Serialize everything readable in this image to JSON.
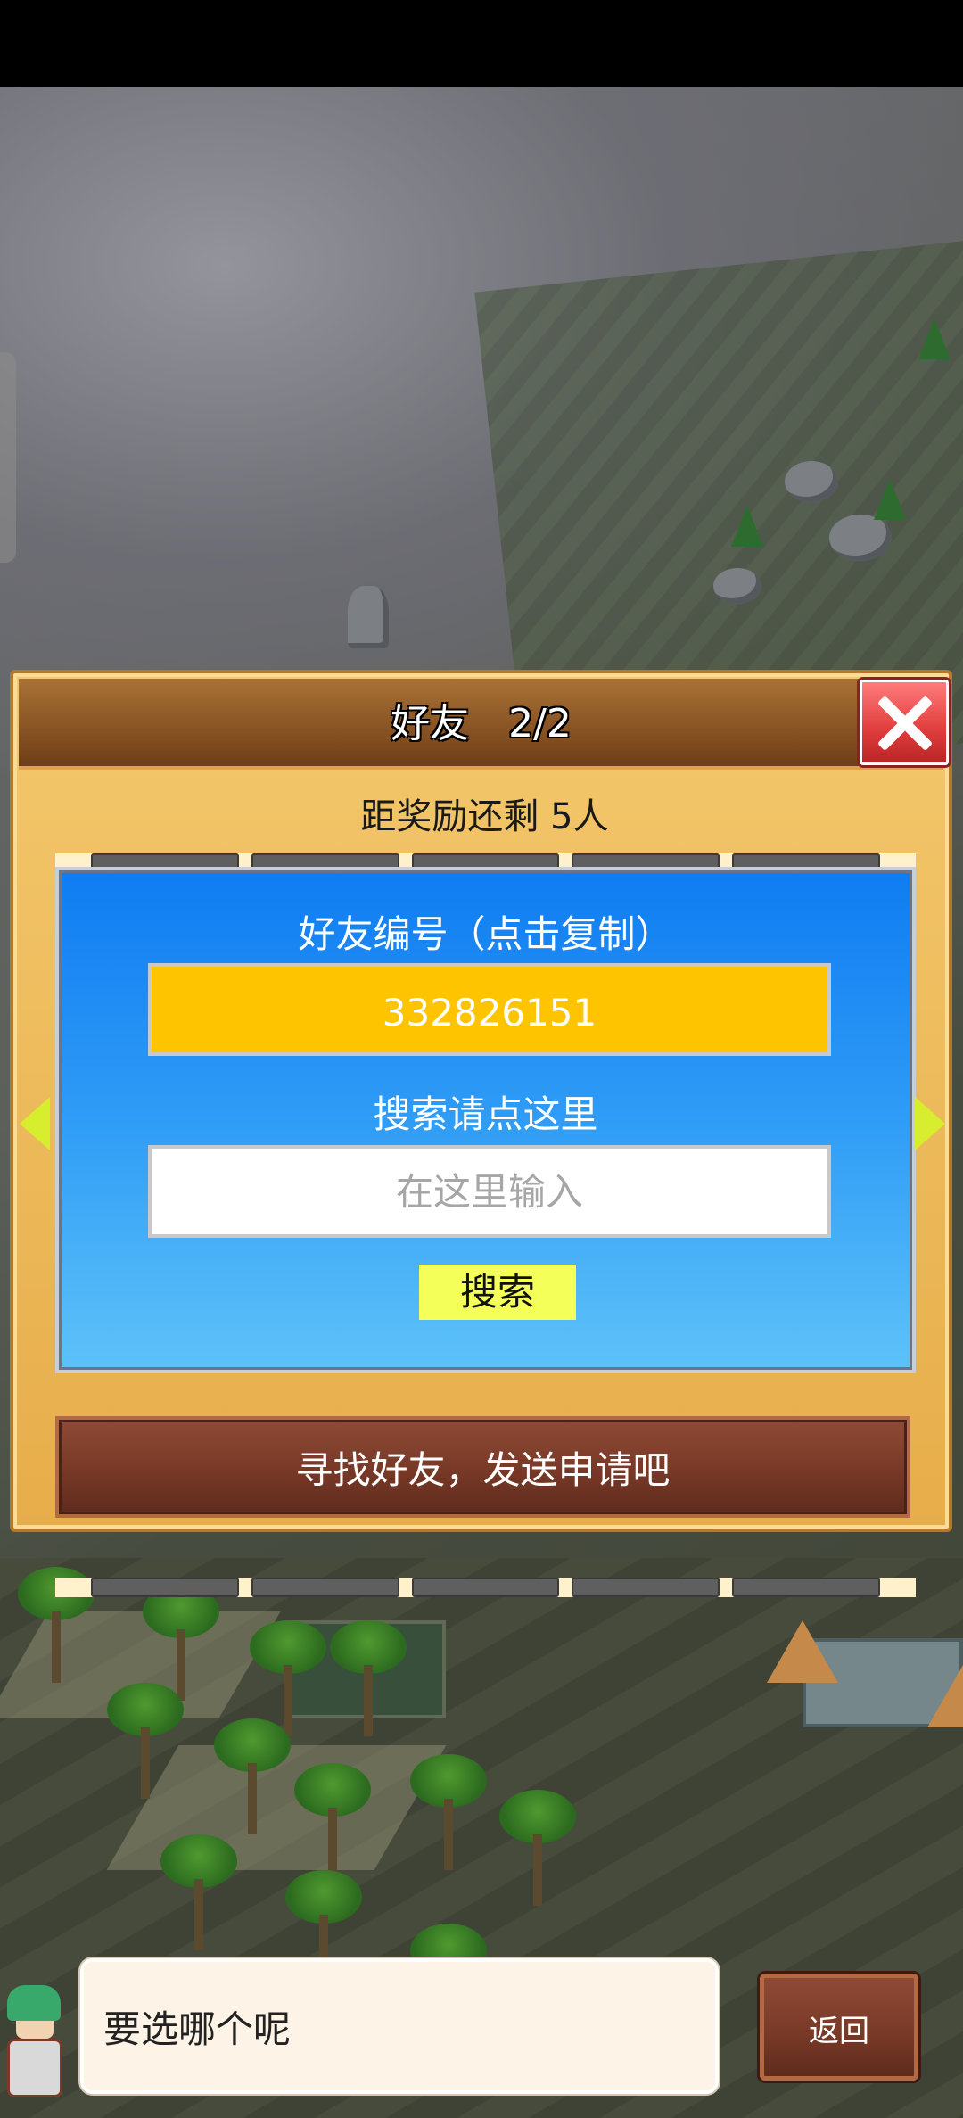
{
  "dialog": {
    "title": "好友　2/2",
    "reward_text": "距奖励还剩 5人",
    "friend_id_label": "好友编号（点击复制）",
    "friend_id": "332826151",
    "search_label": "搜索请点这里",
    "search_placeholder": "在这里输入",
    "search_button": "搜索",
    "find_friends_button": "寻找好友，发送申请吧"
  },
  "advisor": {
    "message": "要选哪个呢"
  },
  "footer": {
    "back_label": "返回"
  },
  "colors": {
    "id_box": "#ffc400",
    "search_button": "#f5ff5a",
    "panel_top": "#0f7cf2",
    "panel_bottom": "#5ec2f8",
    "arrow": "#d7ee2f"
  }
}
